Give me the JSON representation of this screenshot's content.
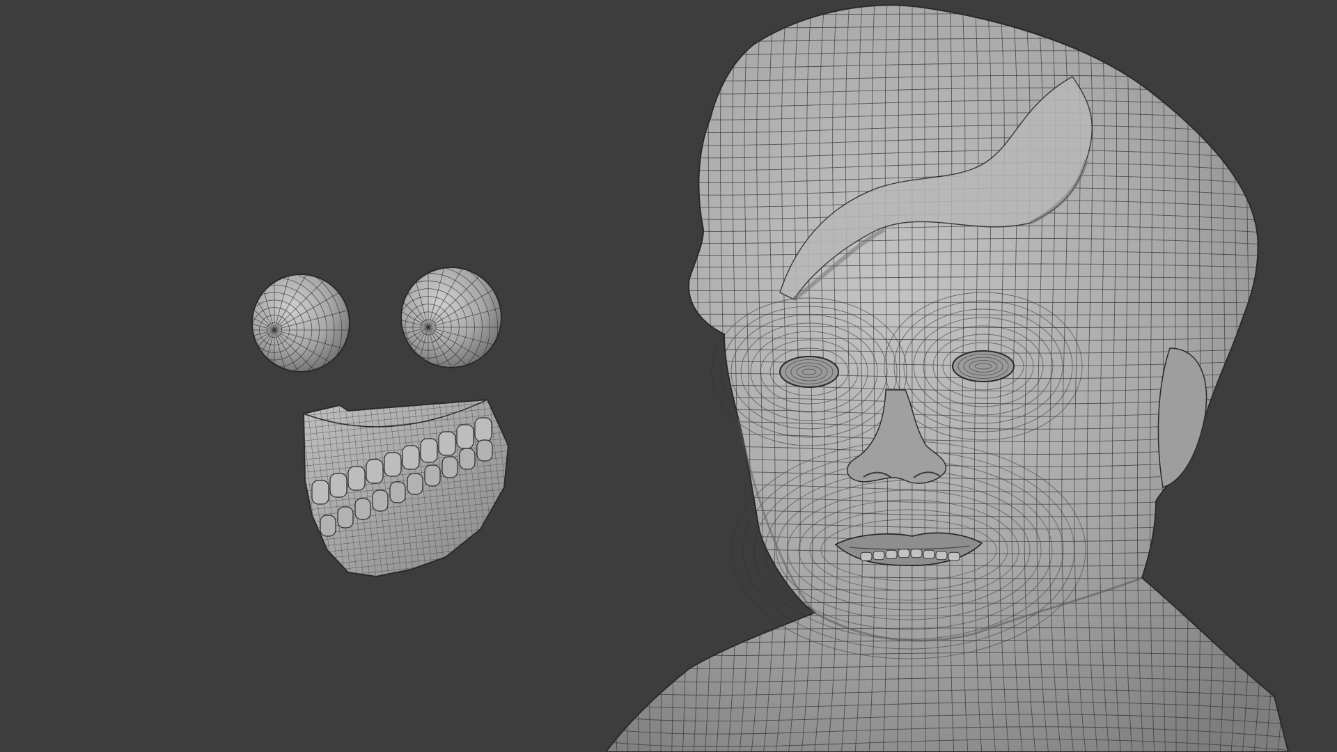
{
  "viewport": {
    "background": "#3d3d3d",
    "mesh_fill": "#a9a9a9",
    "mesh_fill_highlight": "#c8c8c8",
    "mesh_fill_shadow": "#808080",
    "wire_color": "#2e2e2e"
  },
  "objects": [
    {
      "name": "eyeball-left",
      "kind": "sphere"
    },
    {
      "name": "eyeball-right",
      "kind": "sphere"
    },
    {
      "name": "teeth-gums",
      "kind": "teeth"
    },
    {
      "name": "head-bust",
      "kind": "head"
    }
  ]
}
